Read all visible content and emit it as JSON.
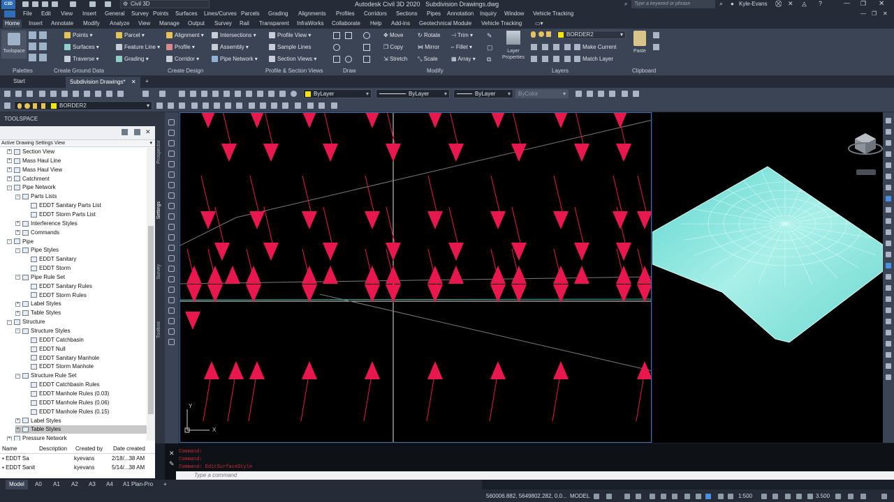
{
  "app": {
    "logo": "C3D",
    "workspace": "Civil 3D",
    "title": "Autodesk Civil 3D 2020",
    "file": "Subdivision Drawings.dwg",
    "search_placeholder": "Type a keyword or phrase",
    "user": "Kyle-Evans"
  },
  "menubar": [
    "File",
    "Edit",
    "View",
    "Insert",
    "General",
    "Survey",
    "Points",
    "Surfaces",
    "Lines/Curves",
    "Parcels",
    "Grading",
    "Alignments",
    "Profiles",
    "Corridors",
    "Sections",
    "Pipes",
    "Annotation",
    "Inquiry",
    "Window",
    "Vehicle Tracking"
  ],
  "ribbon_tabs": [
    "Home",
    "Insert",
    "Annotate",
    "Modify",
    "Analyze",
    "View",
    "Manage",
    "Output",
    "Survey",
    "Rail",
    "Transparent",
    "InfraWorks",
    "Collaborate",
    "Help",
    "Add-ins",
    "Geotechnical Module",
    "Vehicle Tracking"
  ],
  "ribbon": {
    "toolspace": "Toolspace",
    "points": "Points",
    "surfaces": "Surfaces",
    "traverse": "Traverse",
    "parcel": "Parcel",
    "feature_line": "Feature Line",
    "grading": "Grading",
    "alignment": "Alignment",
    "profile": "Profile",
    "corridor": "Corridor",
    "intersections": "Intersections",
    "assembly": "Assembly",
    "pipe_network": "Pipe Network",
    "profile_view": "Profile View",
    "sample_lines": "Sample Lines",
    "section_views": "Section Views",
    "move": "Move",
    "rotate": "Rotate",
    "trim": "Trim",
    "copy": "Copy",
    "mirror": "Mirror",
    "fillet": "Fillet",
    "stretch": "Stretch",
    "scale": "Scale",
    "array": "Array",
    "layer_props_1": "Layer",
    "layer_props_2": "Properties",
    "layer_name": "BORDER2",
    "make_current": "Make Current",
    "match_layer": "Match Layer",
    "paste": "Paste",
    "panels": [
      "Palettes",
      "Create Ground Data",
      "Create Design",
      "Profile & Section Views",
      "Draw",
      "Modify",
      "Layers",
      "Clipboard"
    ]
  },
  "doc_tabs": [
    "Start",
    "Subdivision Drawings*"
  ],
  "toolbar": {
    "color": "ByLayer",
    "linetype": "ByLayer",
    "lineweight": "ByLayer",
    "plotstyle": "ByColor",
    "layer": "BORDER2",
    "color_swatch": "#f7e600"
  },
  "toolspace": {
    "title": "TOOLSPACE",
    "view": "Active Drawing Settings View",
    "side_tabs": [
      "Prospector",
      "Settings",
      "Survey",
      "Toolbox"
    ],
    "tree": [
      {
        "label": "Section View",
        "level": 1,
        "toggle": "+"
      },
      {
        "label": "Mass Haul Line",
        "level": 1,
        "toggle": "+"
      },
      {
        "label": "Mass Haul View",
        "level": 1,
        "toggle": "+"
      },
      {
        "label": "Catchment",
        "level": 1,
        "toggle": "+"
      },
      {
        "label": "Pipe Network",
        "level": 1,
        "toggle": "−"
      },
      {
        "label": "Parts Lists",
        "level": 2,
        "toggle": "−"
      },
      {
        "label": "EDDT Sanitary Parts List",
        "level": 3,
        "toggle": ""
      },
      {
        "label": "EDDT Storm Parts List",
        "level": 3,
        "toggle": ""
      },
      {
        "label": "Interference Styles",
        "level": 2,
        "toggle": "+"
      },
      {
        "label": "Commands",
        "level": 2,
        "toggle": "+"
      },
      {
        "label": "Pipe",
        "level": 1,
        "toggle": "−"
      },
      {
        "label": "Pipe Styles",
        "level": 2,
        "toggle": "−"
      },
      {
        "label": "EDDT Sanitary",
        "level": 3,
        "toggle": ""
      },
      {
        "label": "EDDT Storm",
        "level": 3,
        "toggle": ""
      },
      {
        "label": "Pipe Rule Set",
        "level": 2,
        "toggle": "−"
      },
      {
        "label": "EDDT Sanitary Rules",
        "level": 3,
        "toggle": ""
      },
      {
        "label": "EDDT Storm Rules",
        "level": 3,
        "toggle": ""
      },
      {
        "label": "Label Styles",
        "level": 2,
        "toggle": "+"
      },
      {
        "label": "Table Styles",
        "level": 2,
        "toggle": "+"
      },
      {
        "label": "Structure",
        "level": 1,
        "toggle": "−"
      },
      {
        "label": "Structure Styles",
        "level": 2,
        "toggle": "−"
      },
      {
        "label": "EDDT Catchbasin",
        "level": 3,
        "toggle": ""
      },
      {
        "label": "EDDT Null",
        "level": 3,
        "toggle": ""
      },
      {
        "label": "EDDT Sanitary Manhole",
        "level": 3,
        "toggle": ""
      },
      {
        "label": "EDDT Storm Manhole",
        "level": 3,
        "toggle": ""
      },
      {
        "label": "Structure Rule Set",
        "level": 2,
        "toggle": "−"
      },
      {
        "label": "EDDT Catchbasin Rules",
        "level": 3,
        "toggle": ""
      },
      {
        "label": "EDDT Manhole Rules (0.03)",
        "level": 3,
        "toggle": ""
      },
      {
        "label": "EDDT Manhole Rules (0.06)",
        "level": 3,
        "toggle": ""
      },
      {
        "label": "EDDT Manhole Rules (0.15)",
        "level": 3,
        "toggle": ""
      },
      {
        "label": "Label Styles",
        "level": 2,
        "toggle": "+"
      },
      {
        "label": "Table Styles",
        "level": 2,
        "toggle": "+",
        "selected": true
      },
      {
        "label": "Pressure Network",
        "level": 1,
        "toggle": "+"
      }
    ],
    "list_headers": [
      "Name",
      "Description",
      "Created by",
      "Date created"
    ],
    "list_rows": [
      {
        "name": "EDDT Sa",
        "desc": "",
        "by": "kyevans",
        "date": "2/18/...38 AM"
      },
      {
        "name": "EDDT Sanit",
        "desc": "",
        "by": "kyevans",
        "date": "5/14/...38 AM"
      }
    ]
  },
  "command": {
    "history": [
      "Command:",
      "Command:",
      "Command: EditSurfaceStyle"
    ],
    "placeholder": "Type a command"
  },
  "layout_tabs": [
    "Model",
    "A0",
    "A1",
    "A2",
    "A3",
    "A4",
    "A1 Plan-Pro"
  ],
  "status": {
    "coords": "560006.882, 5649802.282, 0.0...",
    "model": "MODEL",
    "scale": "1:500",
    "zoom": "3.500"
  },
  "viewport": {
    "ucs_x": "X",
    "ucs_y": "Y"
  },
  "colors": {
    "arrow": "#e8174e",
    "surface": "#7fe3dd",
    "accent": "#3f6fae"
  }
}
